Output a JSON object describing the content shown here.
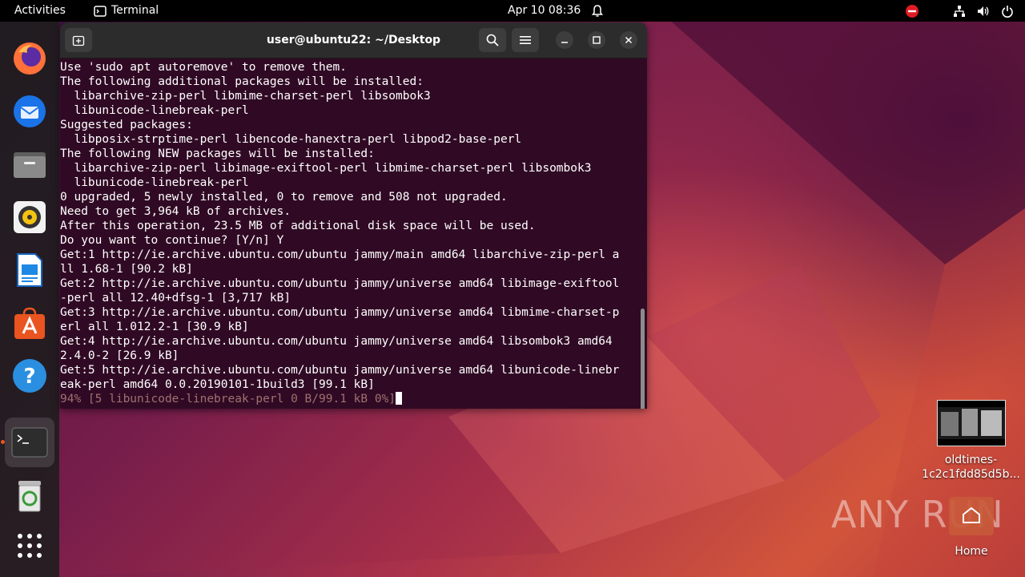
{
  "topbar": {
    "activities": "Activities",
    "app_name": "Terminal",
    "clock": "Apr 10  08:36",
    "icons": [
      "bell-icon",
      "network-icon",
      "volume-icon",
      "power-icon",
      "error-status-icon"
    ]
  },
  "dock": {
    "items": [
      "firefox",
      "thunderbird",
      "files",
      "rhythmbox",
      "libreoffice-writer",
      "ubuntu-software",
      "help",
      "terminal",
      "trash",
      "show-applications"
    ]
  },
  "terminal": {
    "title": "user@ubuntu22: ~/Desktop",
    "lines": [
      "Use 'sudo apt autoremove' to remove them.",
      "The following additional packages will be installed:",
      "  libarchive-zip-perl libmime-charset-perl libsombok3",
      "  libunicode-linebreak-perl",
      "Suggested packages:",
      "  libposix-strptime-perl libencode-hanextra-perl libpod2-base-perl",
      "The following NEW packages will be installed:",
      "  libarchive-zip-perl libimage-exiftool-perl libmime-charset-perl libsombok3",
      "  libunicode-linebreak-perl",
      "0 upgraded, 5 newly installed, 0 to remove and 508 not upgraded.",
      "Need to get 3,964 kB of archives.",
      "After this operation, 23.5 MB of additional disk space will be used.",
      "Do you want to continue? [Y/n] Y",
      "Get:1 http://ie.archive.ubuntu.com/ubuntu jammy/main amd64 libarchive-zip-perl a",
      "ll 1.68-1 [90.2 kB]",
      "Get:2 http://ie.archive.ubuntu.com/ubuntu jammy/universe amd64 libimage-exiftool",
      "-perl all 12.40+dfsg-1 [3,717 kB]",
      "Get:3 http://ie.archive.ubuntu.com/ubuntu jammy/universe amd64 libmime-charset-p",
      "erl all 1.012.2-1 [30.9 kB]",
      "Get:4 http://ie.archive.ubuntu.com/ubuntu jammy/universe amd64 libsombok3 amd64",
      "2.4.0-2 [26.9 kB]",
      "Get:5 http://ie.archive.ubuntu.com/ubuntu jammy/universe amd64 libunicode-linebr",
      "eak-perl amd64 0.0.20190101-1build3 [99.1 kB]"
    ],
    "progress_line": "94% [5 libunicode-linebreak-perl 0 B/99.1 kB 0%]"
  },
  "desktop": {
    "file_label": "oldtimes-1c2c1fdd85d5b...",
    "home_label": "Home",
    "watermark": "ANY RUN"
  },
  "colors": {
    "terminal_bg": "#300a24",
    "ubuntu_orange": "#e95420",
    "titlebar": "#2c2c2c"
  }
}
